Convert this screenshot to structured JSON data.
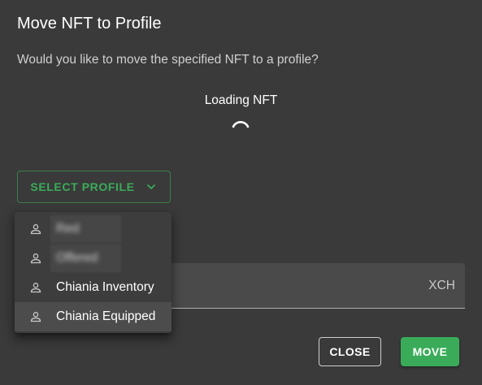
{
  "dialog": {
    "title": "Move NFT to Profile",
    "description": "Would you like to move the specified NFT to a profile?",
    "loading_label": "Loading NFT"
  },
  "profile_select": {
    "label": "SELECT PROFILE",
    "icon": "chevron-down-icon"
  },
  "fee_field": {
    "unit": "XCH",
    "value": ""
  },
  "profile_menu": {
    "items": [
      {
        "label": "Red",
        "icon": "person-icon",
        "obscured": true
      },
      {
        "label": "Offered",
        "icon": "person-icon",
        "obscured": true
      },
      {
        "label": "Chiania Inventory",
        "icon": "person-icon",
        "obscured": false
      },
      {
        "label": "Chiania Equipped",
        "icon": "person-icon",
        "obscured": false,
        "selected": true
      }
    ]
  },
  "actions": {
    "close_label": "CLOSE",
    "move_label": "MOVE"
  },
  "colors": {
    "accent": "#3aac59",
    "background": "#3a3a3a",
    "menu_background": "#3d3d3d"
  }
}
